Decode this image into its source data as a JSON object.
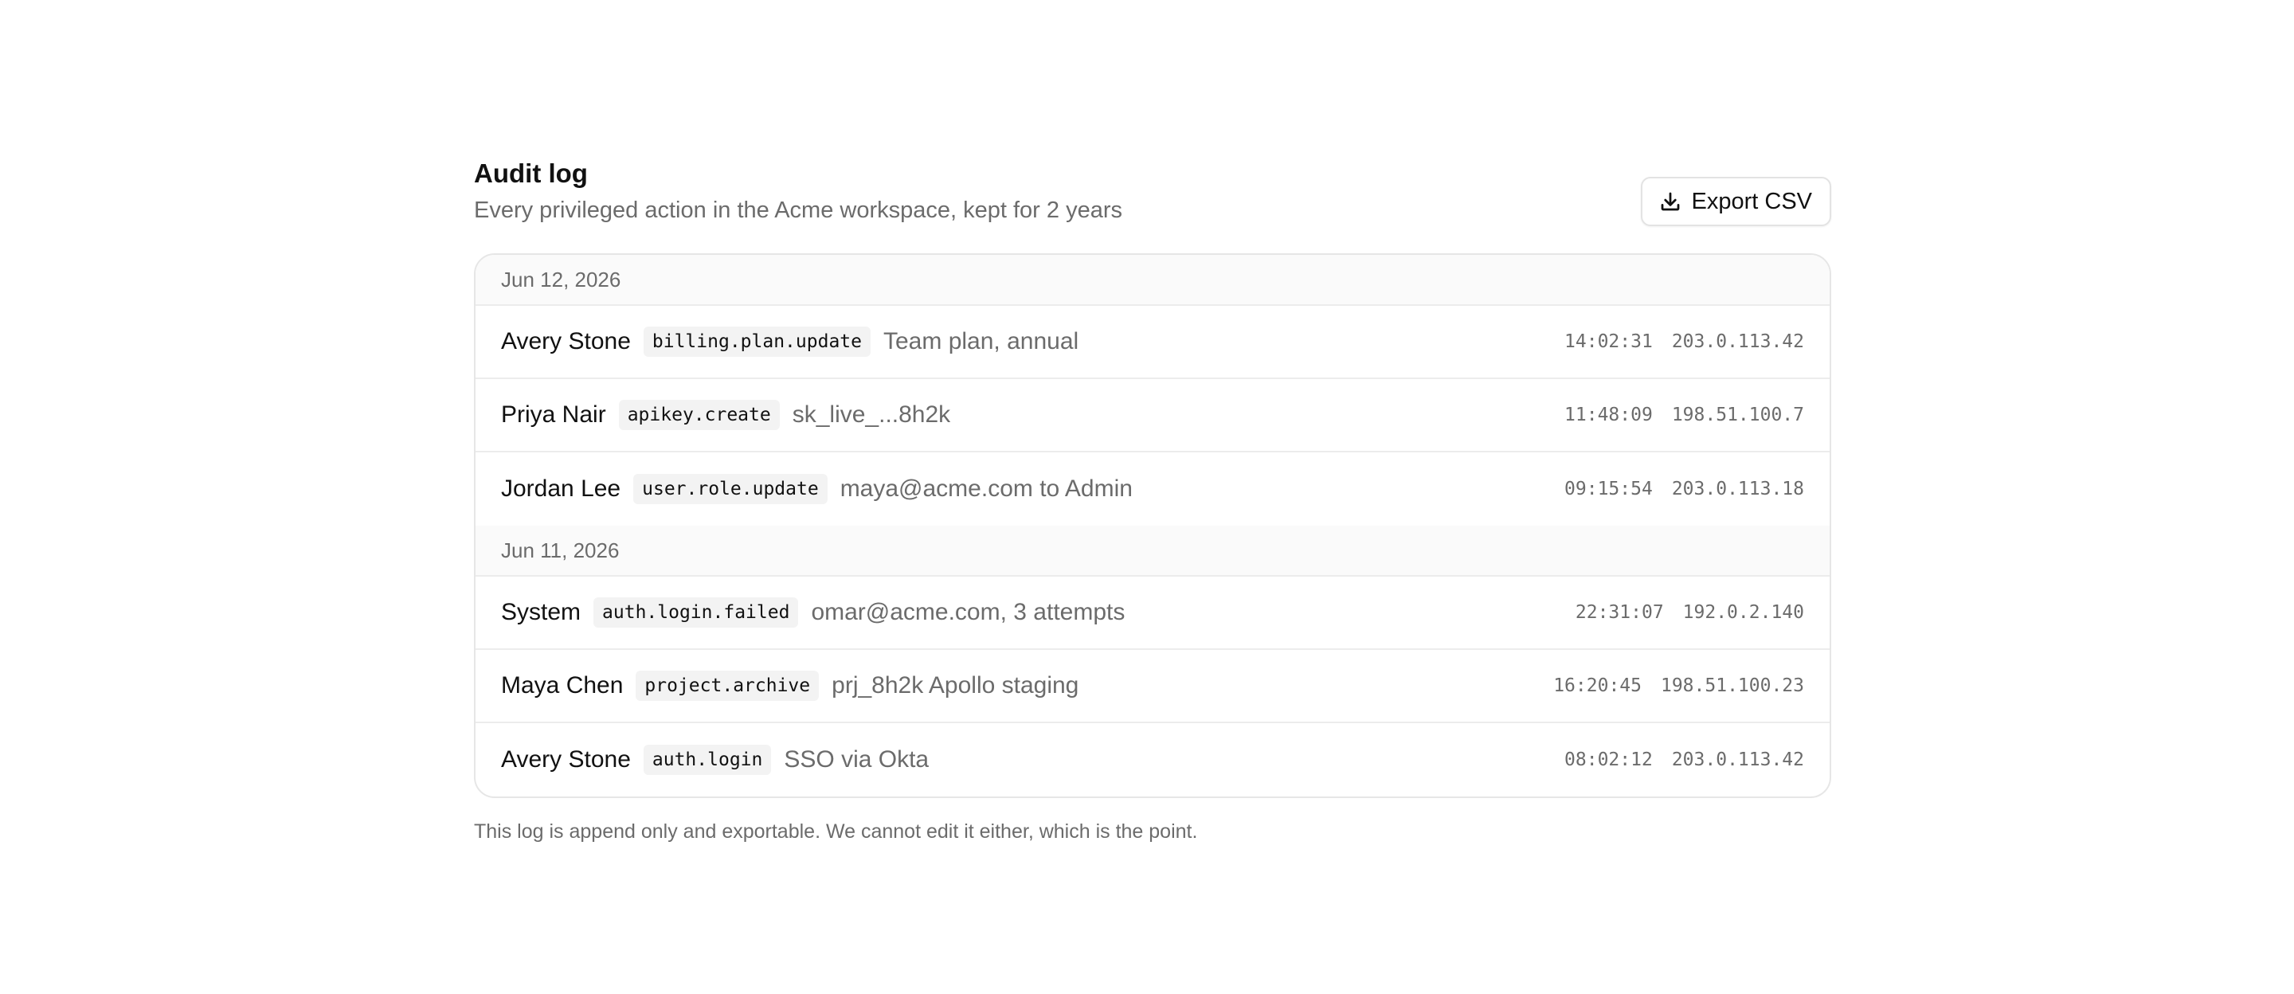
{
  "header": {
    "title": "Audit log",
    "subtitle": "Every privileged action in the Acme workspace, kept for 2 years",
    "export_label": "Export CSV"
  },
  "groups": [
    {
      "date": "Jun 12, 2026",
      "entries": [
        {
          "actor": "Avery Stone",
          "action": "billing.plan.update",
          "detail": "Team plan, annual",
          "time": "14:02:31",
          "ip": "203.0.113.42"
        },
        {
          "actor": "Priya Nair",
          "action": "apikey.create",
          "detail": "sk_live_...8h2k",
          "time": "11:48:09",
          "ip": "198.51.100.7"
        },
        {
          "actor": "Jordan Lee",
          "action": "user.role.update",
          "detail": "maya@acme.com to Admin",
          "time": "09:15:54",
          "ip": "203.0.113.18"
        }
      ]
    },
    {
      "date": "Jun 11, 2026",
      "entries": [
        {
          "actor": "System",
          "action": "auth.login.failed",
          "detail": "omar@acme.com, 3 attempts",
          "time": "22:31:07",
          "ip": "192.0.2.140"
        },
        {
          "actor": "Maya Chen",
          "action": "project.archive",
          "detail": "prj_8h2k Apollo staging",
          "time": "16:20:45",
          "ip": "198.51.100.23"
        },
        {
          "actor": "Avery Stone",
          "action": "auth.login",
          "detail": "SSO via Okta",
          "time": "08:02:12",
          "ip": "203.0.113.42"
        }
      ]
    }
  ],
  "footnote": "This log is append only and exportable. We cannot edit it either, which is the point."
}
